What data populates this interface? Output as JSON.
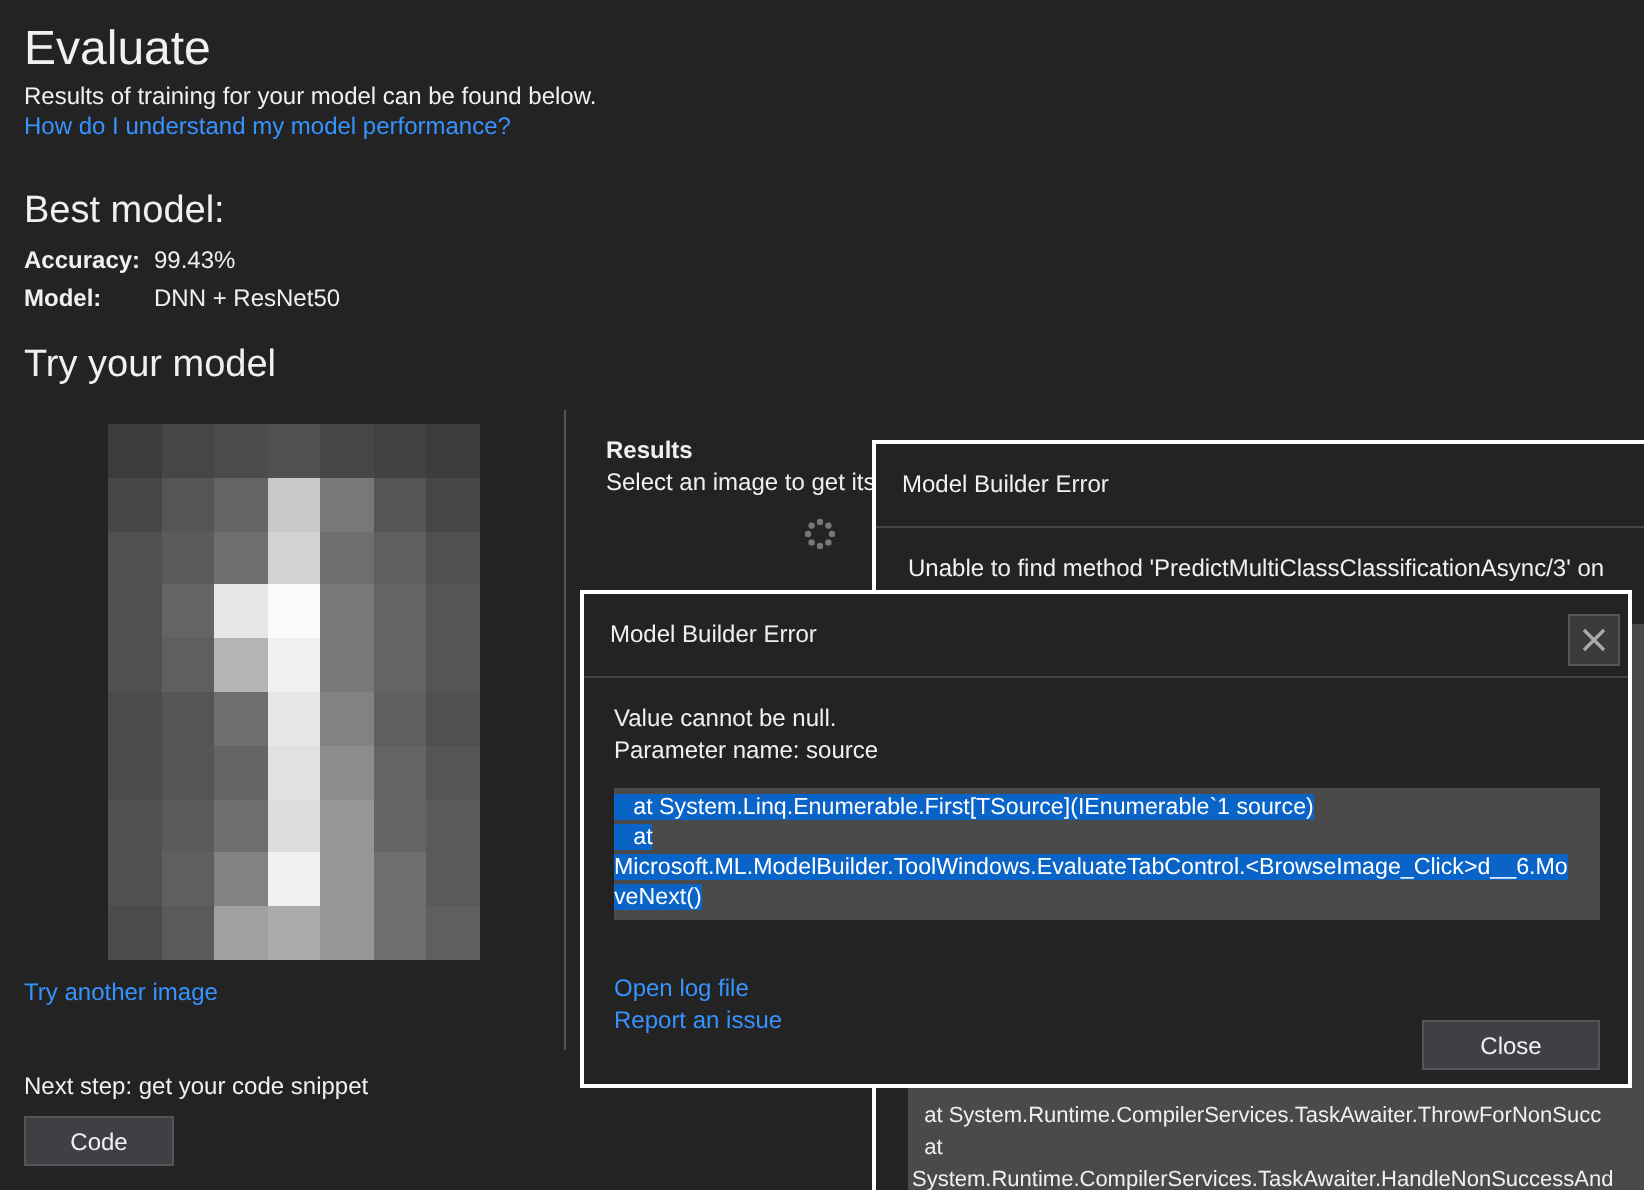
{
  "page": {
    "title": "Evaluate",
    "subtitle": "Results of training for your model can be found below.",
    "help_link": "How do I understand my model performance?"
  },
  "best_model": {
    "heading": "Best model:",
    "metrics": [
      {
        "label": "Accuracy:",
        "value": "99.43%"
      },
      {
        "label": "Model:",
        "value": "DNN + ResNet50"
      }
    ]
  },
  "try_model": {
    "heading": "Try your model",
    "try_another_link": "Try another image"
  },
  "next_step": {
    "label": "Next step: get your code snippet",
    "button": "Code"
  },
  "results": {
    "heading": "Results",
    "text": "Select an image to get its"
  },
  "dialogs": [
    {
      "title": "Model Builder Error",
      "message": [
        "Unable to find method 'PredictMultiClassClassificationAsync/3' on"
      ],
      "trace": [
        "  at System.Runtime.CompilerServices.TaskAwaiter.ThrowForNonSucc",
        "  at",
        "System.Runtime.CompilerServices.TaskAwaiter.HandleNonSuccessAnd"
      ],
      "trace_selected": false
    },
    {
      "title": "Model Builder Error",
      "message": [
        "Value cannot be null.",
        "Parameter name: source"
      ],
      "trace": [
        "   at System.Linq.Enumerable.First[TSource](IEnumerable`1 source)",
        "   at",
        "Microsoft.ML.ModelBuilder.ToolWindows.EvaluateTabControl.<BrowseImage_Click>d__6.Mo",
        "veNext()"
      ],
      "trace_selected": true,
      "links": [
        "Open log file",
        "Report an issue"
      ],
      "close_button": "Close"
    }
  ]
}
